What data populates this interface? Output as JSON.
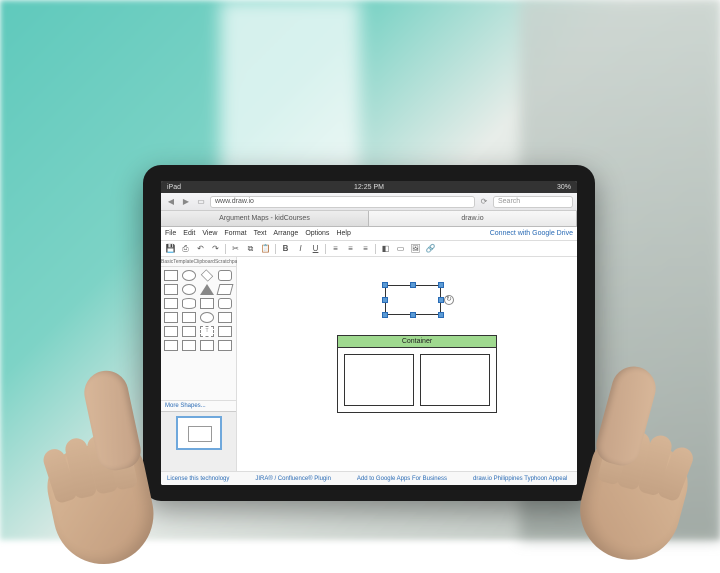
{
  "ipad_status": {
    "device": "iPad",
    "time": "12:25 PM",
    "battery": "30%"
  },
  "browser": {
    "url": "www.draw.io",
    "search_placeholder": "Search"
  },
  "tabs": [
    {
      "label": "Argument Maps - kidCourses"
    },
    {
      "label": "draw.io"
    }
  ],
  "menu": {
    "items": [
      "File",
      "Edit",
      "View",
      "Format",
      "Text",
      "Arrange",
      "Options",
      "Help"
    ],
    "connect": "Connect with Google Drive"
  },
  "sidebar": {
    "tabs": [
      "Basic",
      "Template",
      "Clipboard",
      "Scratchpad"
    ],
    "more": "More Shapes..."
  },
  "canvas": {
    "container_label": "Container"
  },
  "footer": {
    "links": [
      "License this technology",
      "JIRA® / Confluence® Plugin",
      "Add to Google Apps For Business",
      "draw.io Philippines Typhoon Appeal"
    ]
  }
}
